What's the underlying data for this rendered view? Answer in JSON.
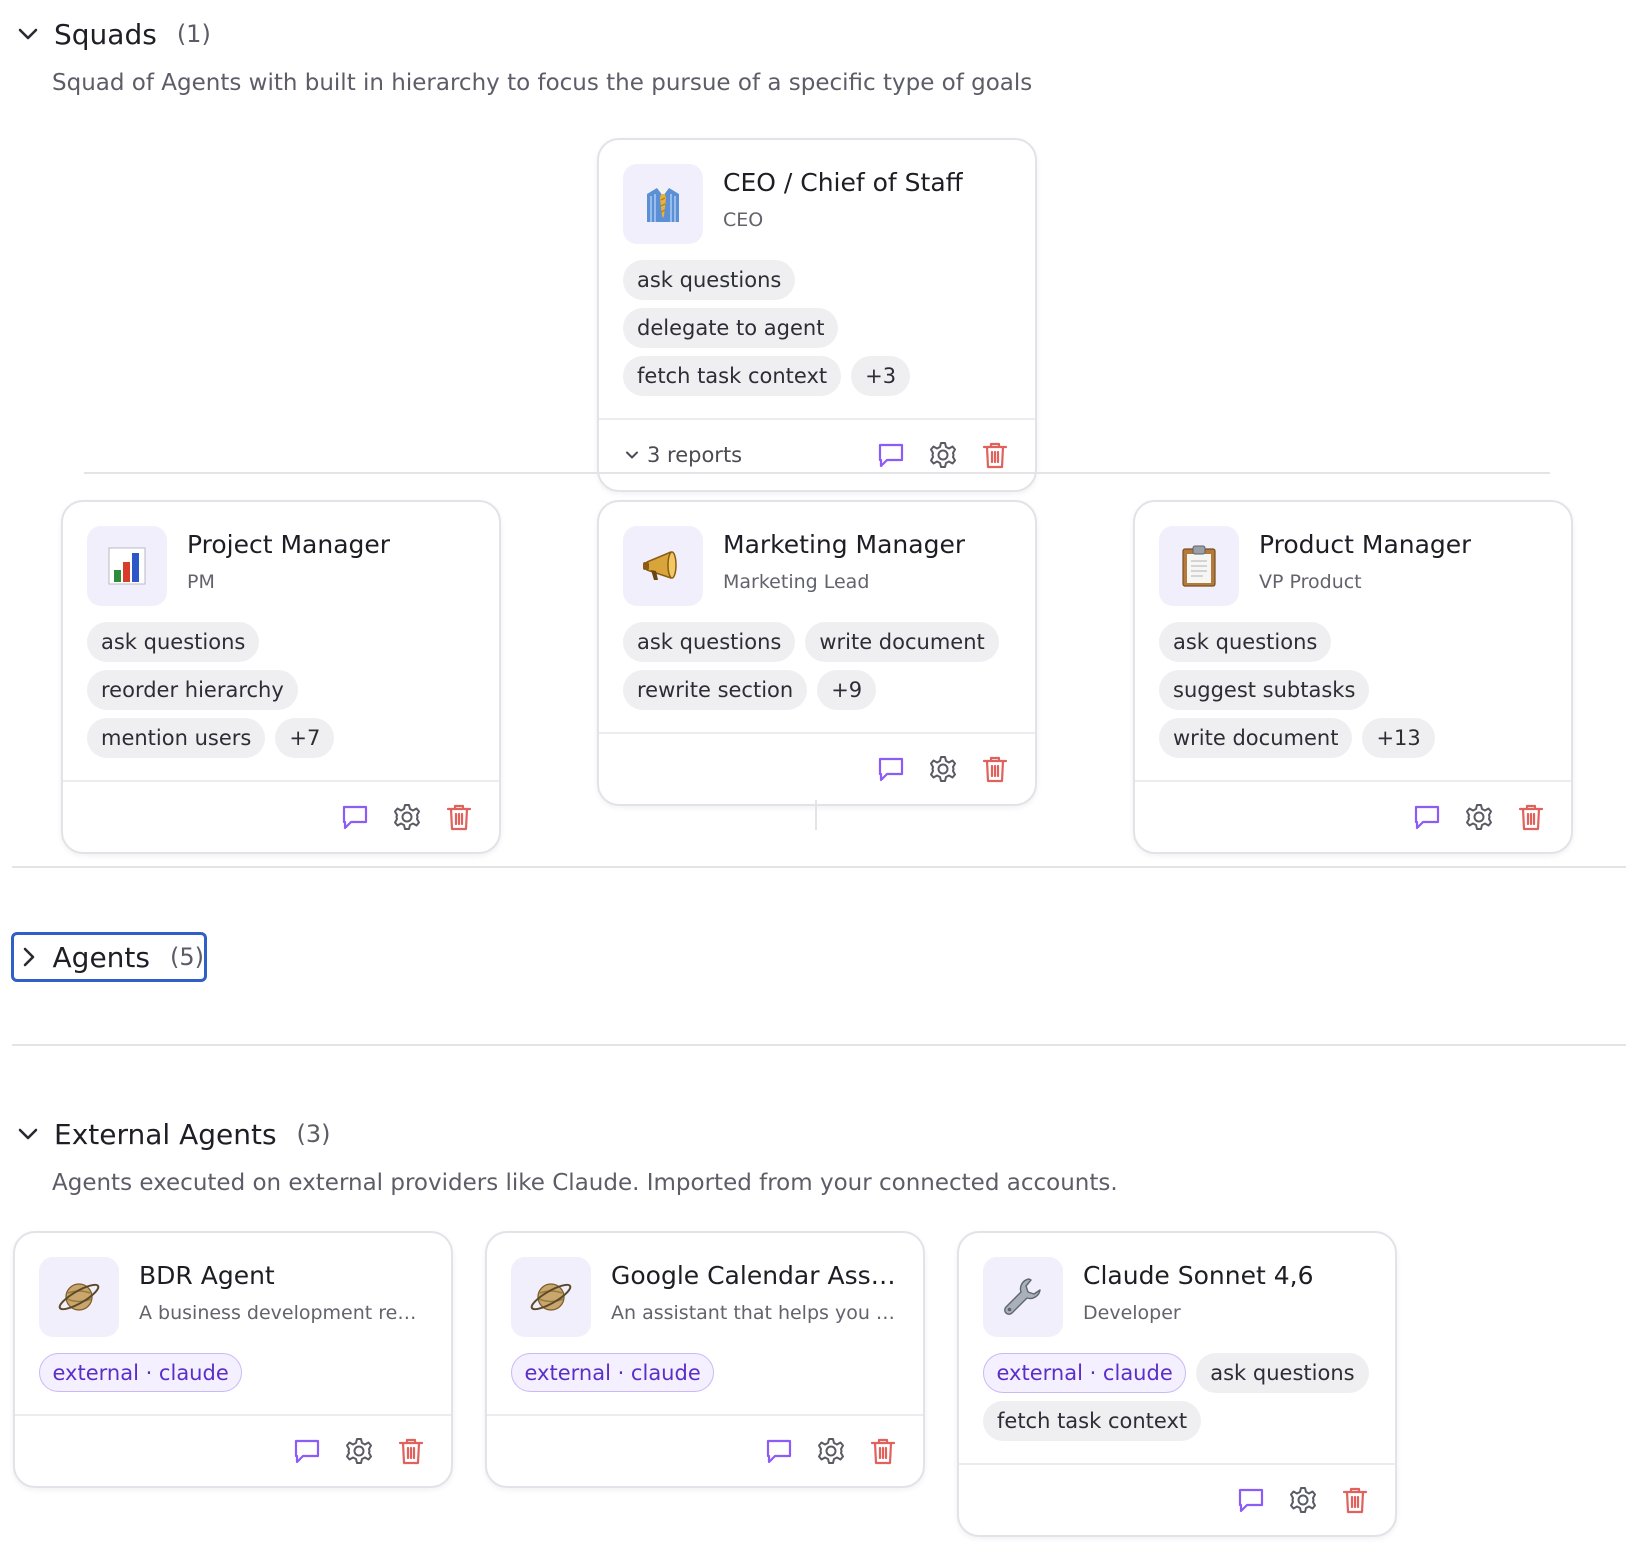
{
  "squads": {
    "title": "Squads",
    "count": "(1)",
    "description": "Squad of Agents with built in hierarchy to focus the pursue of a specific type of goals",
    "lead": {
      "name": "CEO / Chief of Staff",
      "role": "CEO",
      "avatar_icon": "necktie-shirt-emoji",
      "chips": [
        "ask questions",
        "delegate to agent",
        "fetch task context",
        "+3"
      ],
      "reports_label": "3 reports"
    },
    "members": [
      {
        "name": "Project Manager",
        "role": "PM",
        "avatar_icon": "bar-chart-emoji",
        "chips": [
          "ask questions",
          "reorder hierarchy",
          "mention users",
          "+7"
        ]
      },
      {
        "name": "Marketing Manager",
        "role": "Marketing Lead",
        "avatar_icon": "megaphone-emoji",
        "chips": [
          "ask questions",
          "write document",
          "rewrite section",
          "+9"
        ]
      },
      {
        "name": "Product Manager",
        "role": "VP Product",
        "avatar_icon": "clipboard-emoji",
        "chips": [
          "ask questions",
          "suggest subtasks",
          "write document",
          "+13"
        ]
      }
    ]
  },
  "agents": {
    "title": "Agents",
    "count": "(5)"
  },
  "external": {
    "title": "External Agents",
    "count": "(3)",
    "description": "Agents executed on external providers like Claude. Imported from your connected accounts.",
    "cards": [
      {
        "name": "BDR Agent",
        "role": "A business development repr...",
        "avatar_icon": "ringed-planet-emoji",
        "badge": "external · claude",
        "chips": []
      },
      {
        "name": "Google Calendar Assis...",
        "role": "An assistant that helps you m...",
        "avatar_icon": "ringed-planet-emoji",
        "badge": "external · claude",
        "chips": []
      },
      {
        "name": "Claude Sonnet 4,6",
        "role": "Developer",
        "avatar_icon": "wrench-emoji",
        "badge": "external · claude",
        "chips": [
          "ask questions",
          "fetch task context"
        ]
      }
    ]
  },
  "colors": {
    "chat_icon": "#8b5cf6",
    "settings_icon": "#5a5a64",
    "delete_icon": "#e0625c",
    "focus_ring": "#2f5fc7"
  }
}
